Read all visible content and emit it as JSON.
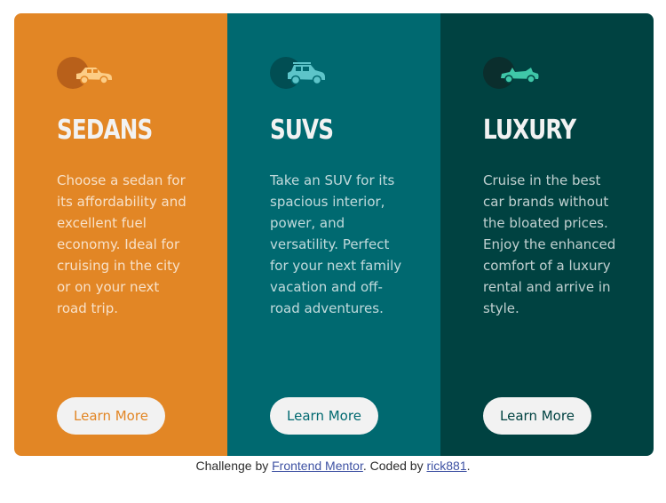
{
  "cards": [
    {
      "icon": "sedan-car-icon",
      "title": "SEDANS",
      "description": "Choose a sedan for its affordability and excellent fuel economy. Ideal for cruising in the city or on your next road trip.",
      "button_label": "Learn More",
      "bg_color": "#e28625",
      "accent_color": "#e28625"
    },
    {
      "icon": "suv-car-icon",
      "title": "SUVS",
      "description": "Take an SUV for its spacious interior, power, and versatility. Perfect for your next family vacation and off-road adventures.",
      "button_label": "Learn More",
      "bg_color": "#006970",
      "accent_color": "#006970"
    },
    {
      "icon": "luxury-car-icon",
      "title": "LUXURY",
      "description": "Cruise in the best car brands without the bloated prices. Enjoy the enhanced comfort of a luxury rental and arrive in style.",
      "button_label": "Learn More",
      "bg_color": "#004241",
      "accent_color": "#004241"
    }
  ],
  "footer": {
    "prefix": "Challenge by ",
    "challenge_link": "Frontend Mentor",
    "middle": ". Coded by ",
    "author_link": "rick881",
    "suffix": "."
  }
}
